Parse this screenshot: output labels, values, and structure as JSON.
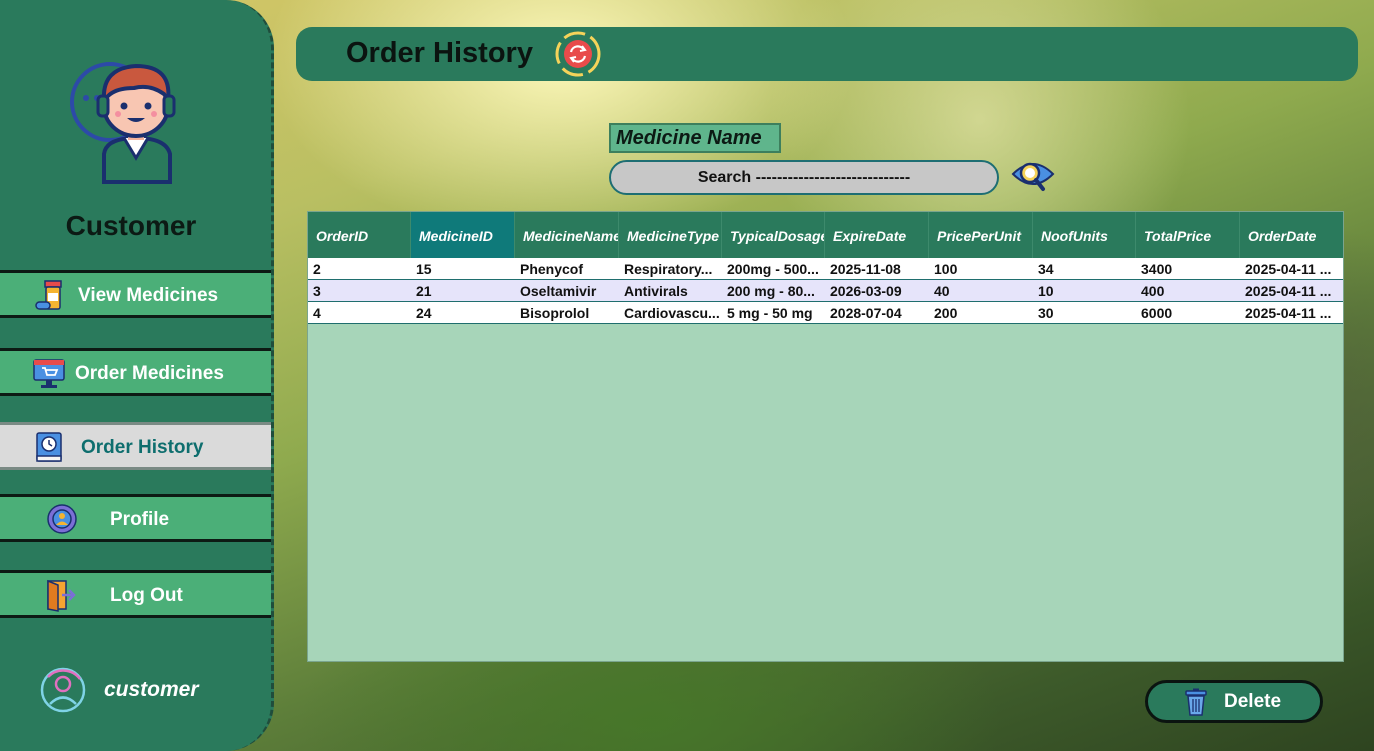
{
  "sidebar": {
    "role_title": "Customer",
    "items": [
      {
        "label": "View Medicines",
        "icon": "pill-bottle-icon"
      },
      {
        "label": "Order Medicines",
        "icon": "shop-cart-monitor-icon"
      },
      {
        "label": "Order History",
        "icon": "history-book-icon",
        "active": true
      },
      {
        "label": "Profile",
        "icon": "gear-user-icon"
      },
      {
        "label": "Log Out",
        "icon": "exit-door-icon"
      }
    ],
    "username": "customer"
  },
  "header": {
    "title": "Order History",
    "refresh_icon": "refresh-icon"
  },
  "search": {
    "label": "Medicine Name",
    "placeholder": "Search -----------------------------",
    "icon": "eye-magnifier-icon"
  },
  "table": {
    "columns": [
      "OrderID",
      "MedicineID",
      "MedicineName",
      "MedicineType",
      "TypicalDosage",
      "ExpireDate",
      "PricePerUnit",
      "NoofUnits",
      "TotalPrice",
      "OrderDate"
    ],
    "rows": [
      [
        "2",
        "15",
        "Phenycof",
        "Respiratory...",
        "200mg - 500...",
        "2025-11-08",
        "100",
        "34",
        "3400",
        "2025-04-11 ..."
      ],
      [
        "3",
        "21",
        "Oseltamivir",
        "Antivirals",
        "200 mg - 80...",
        "2026-03-09",
        "40",
        "10",
        "400",
        "2025-04-11 ..."
      ],
      [
        "4",
        "24",
        "Bisoprolol",
        "Cardiovascu...",
        "5 mg - 50 mg",
        "2028-07-04",
        "200",
        "30",
        "6000",
        "2025-04-11 ..."
      ]
    ]
  },
  "actions": {
    "delete_label": "Delete"
  },
  "colors": {
    "panel_green": "#2a7a5c",
    "nav_green": "#4baf78",
    "grid_bg": "#a7d5b9",
    "selected_header": "#0f7a7a"
  }
}
